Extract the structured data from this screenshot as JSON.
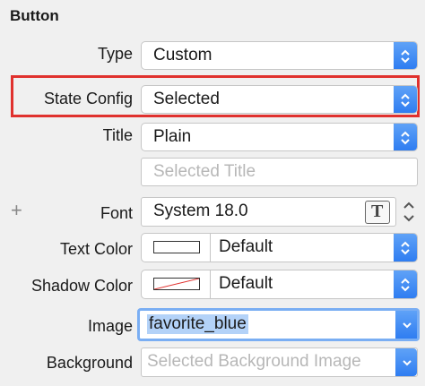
{
  "section_title": "Button",
  "rows": {
    "type": {
      "label": "Type",
      "value": "Custom"
    },
    "state_config": {
      "label": "State Config",
      "value": "Selected"
    },
    "title": {
      "label": "Title",
      "value": "Plain",
      "placeholder": "Selected Title"
    },
    "font": {
      "label": "Font",
      "value": "System 18.0",
      "add_glyph": "+"
    },
    "text_color": {
      "label": "Text Color",
      "value": "Default"
    },
    "shadow_color": {
      "label": "Shadow Color",
      "value": "Default"
    },
    "image": {
      "label": "Image",
      "value": "favorite_blue"
    },
    "background": {
      "label": "Background",
      "placeholder": "Selected Background Image"
    }
  },
  "colors": {
    "accent": "#2f7df1",
    "highlight": "#e0312e",
    "selection": "#b3d2f8"
  }
}
